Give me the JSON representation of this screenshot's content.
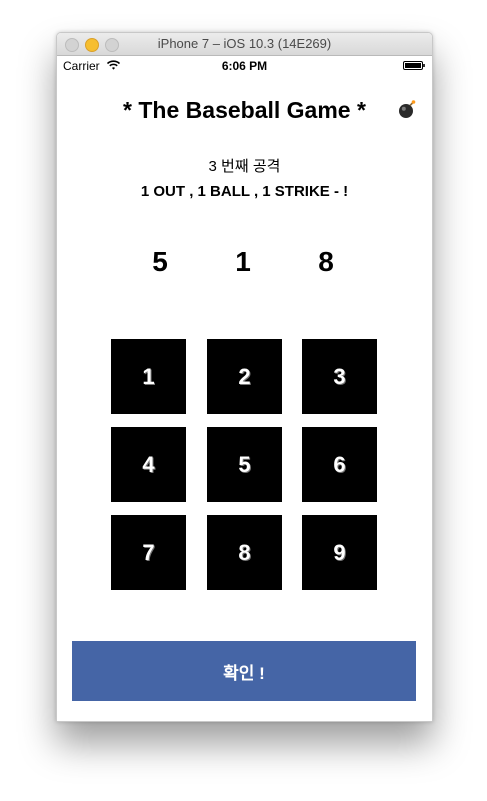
{
  "window": {
    "title": "iPhone 7 – iOS 10.3 (14E269)"
  },
  "status_bar": {
    "carrier": "Carrier",
    "time": "6:06 PM"
  },
  "game": {
    "title": "* The Baseball Game *",
    "attack_label": "3 번째 공격",
    "result_label": "1 OUT , 1 BALL , 1 STRIKE - !",
    "guess": [
      "5",
      "1",
      "8"
    ]
  },
  "keypad": {
    "keys": [
      "1",
      "2",
      "3",
      "4",
      "5",
      "6",
      "7",
      "8",
      "9"
    ]
  },
  "confirm_button": {
    "label": "확인 !"
  },
  "colors": {
    "key_bg": "#000000",
    "confirm_bg": "#4565a6",
    "minimize_light": "#f6be2f"
  },
  "icons": [
    "wifi-icon",
    "battery-icon",
    "bomb-icon"
  ]
}
